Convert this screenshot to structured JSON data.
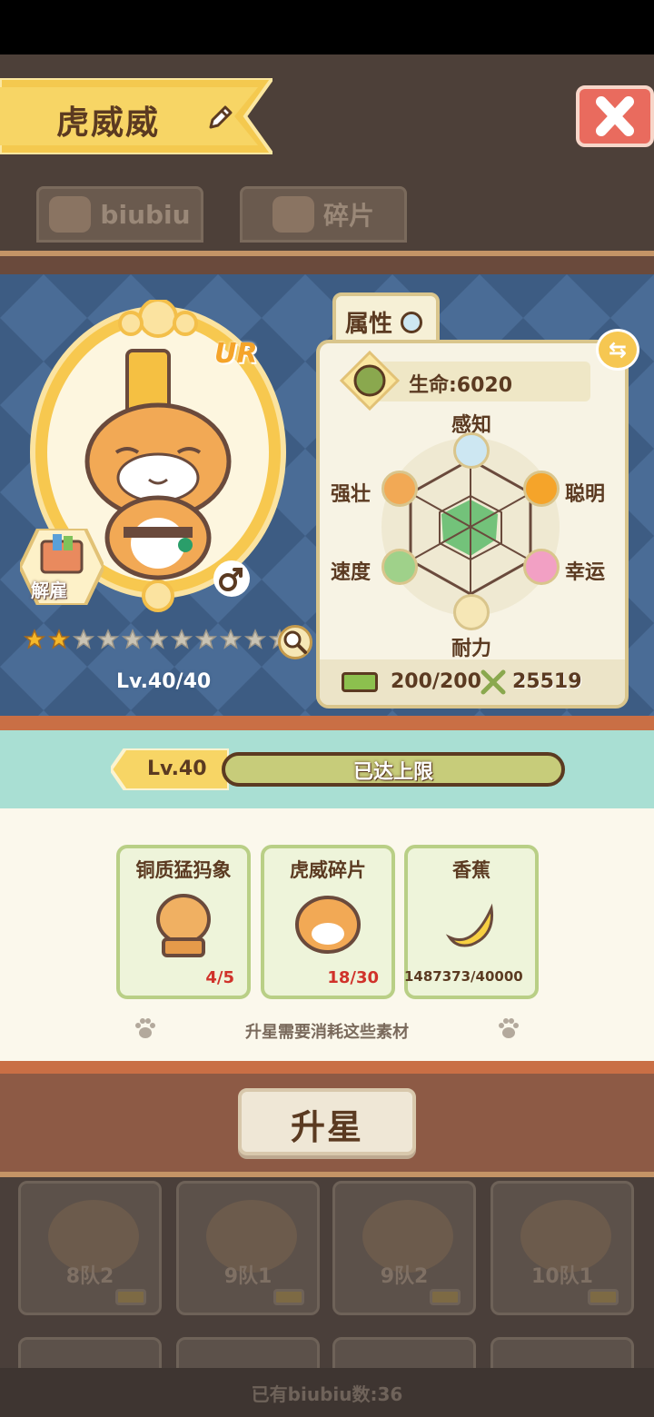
{
  "header": {
    "name": "虎威威",
    "tabs": [
      {
        "label": "biubiu"
      },
      {
        "label": "碎片"
      }
    ]
  },
  "character": {
    "rarity": "UR",
    "dismiss_label": "解雇",
    "gender": "male",
    "stars_filled": 2,
    "stars_total": 11,
    "level": "Lv.40/40"
  },
  "attributes": {
    "tab_label": "属性",
    "hp": "生命:6020",
    "stats": {
      "perception": "感知",
      "smart": "聪明",
      "luck": "幸运",
      "stamina": "耐力",
      "speed": "速度",
      "strong": "强壮"
    },
    "energy": "200/200",
    "power": "25519"
  },
  "level_bar": {
    "tag": "Lv.40",
    "status": "已达上限"
  },
  "materials": {
    "items": [
      {
        "name": "铜质猛犸象",
        "count": "4/5"
      },
      {
        "name": "虎威碎片",
        "count": "18/30"
      },
      {
        "name": "香蕉",
        "count": "1487373/40000"
      }
    ],
    "hint": "升星需要消耗这些素材"
  },
  "upgrade": {
    "label": "升星"
  },
  "background_teams": [
    {
      "label": "8队2"
    },
    {
      "label": "9队1"
    },
    {
      "label": "9队2"
    },
    {
      "label": "10队1"
    }
  ],
  "owned_count": "已有biubiu数:36",
  "colors": {
    "stage_bg": "#3d5c83",
    "accent_orange": "#f5a42a",
    "teal_strip": "#a9dfd3",
    "close_red": "#e96b5e",
    "count_red": "#d0322a"
  }
}
